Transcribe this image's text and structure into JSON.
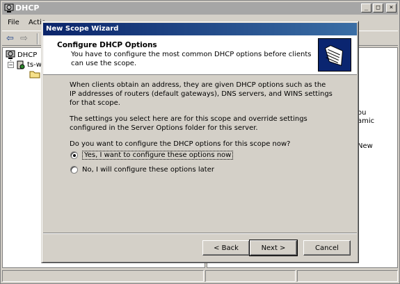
{
  "app": {
    "title": "DHCP",
    "menu": [
      "File",
      "Actio"
    ],
    "window_buttons": [
      "_",
      "□",
      "×"
    ]
  },
  "tree": {
    "root_label": "DHCP",
    "server_label": "ts-w",
    "expander": "−"
  },
  "right_pane": {
    "fragments": [
      "ou",
      "amic",
      "New"
    ]
  },
  "wizard": {
    "title": "New Scope Wizard",
    "header_title": "Configure DHCP Options",
    "header_subtitle": "You have to configure the most common DHCP options before clients can use the scope.",
    "body_paragraphs": [
      "When clients obtain an address, they are given DHCP options such as the IP addresses of routers (default gateways), DNS servers, and WINS settings for that scope.",
      "The settings you select here are for this scope and override settings configured in the Server Options folder for this server.",
      "Do you want to configure the DHCP options for this scope now?"
    ],
    "options": [
      {
        "label": "Yes, I want to configure these options now",
        "checked": true
      },
      {
        "label": "No, I will configure these options later",
        "checked": false
      }
    ],
    "buttons": {
      "back": "< Back",
      "next": "Next >",
      "cancel": "Cancel"
    }
  }
}
